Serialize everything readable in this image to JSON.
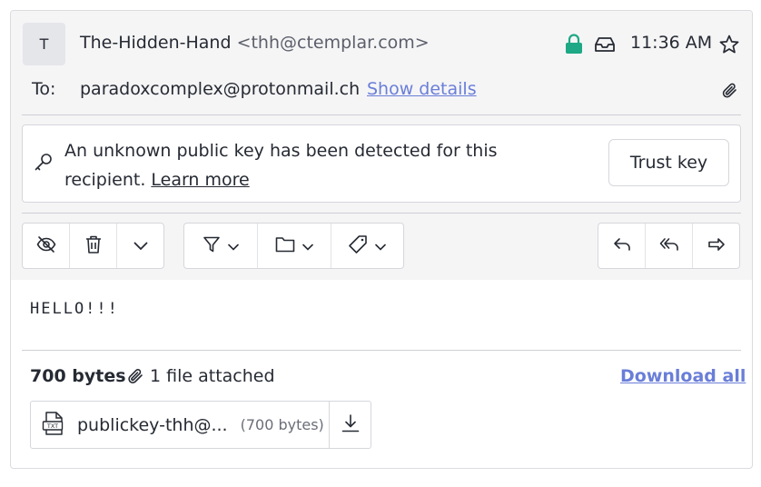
{
  "header": {
    "avatar_initial": "T",
    "sender_name": "The-Hidden-Hand",
    "sender_address": "<thh@ctemplar.com>",
    "time": "11:36 AM",
    "to_label": "To:",
    "to_address": "paradoxcomplex@protonmail.ch",
    "show_details": "Show details",
    "lock_color": "#1ea885"
  },
  "banner": {
    "message_line1": "An unknown public key has been detected for this",
    "message_line2": "recipient.",
    "learn_more": "Learn more",
    "trust_button": "Trust key"
  },
  "toolbar": {
    "groups": [
      [
        "eye-slash-icon",
        "trash-icon",
        "chevron-down-icon"
      ],
      [
        "filter-icon",
        "folder-icon",
        "label-icon"
      ],
      [
        "reply-icon",
        "reply-all-icon",
        "forward-icon"
      ]
    ]
  },
  "message": {
    "body": "HELLO!!!"
  },
  "attachments": {
    "total_size": "700 bytes",
    "count_label": "1 file attached",
    "download_all": "Download all",
    "files": [
      {
        "name": "publickey-thh@...",
        "size": "(700 bytes)",
        "icon": "txt-file-icon"
      }
    ]
  },
  "colors": {
    "link": "#6a7ed8",
    "text": "#262a33"
  }
}
